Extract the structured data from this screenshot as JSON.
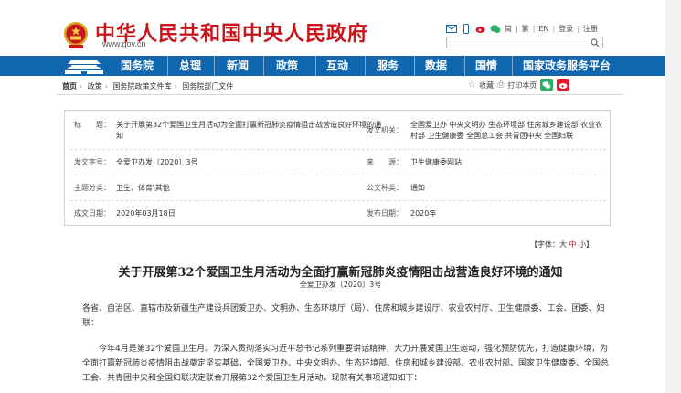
{
  "header": {
    "site_title": "中华人民共和国中央人民政府",
    "site_url": "www.gov.cn",
    "links": [
      "简",
      "繁",
      "EN",
      "登录",
      "注册"
    ],
    "search_placeholder": ""
  },
  "nav": {
    "items": [
      "国务院",
      "总理",
      "新闻",
      "政策",
      "互动",
      "服务",
      "数据",
      "国情",
      "国家政务服务平台"
    ]
  },
  "breadcrumb": {
    "items": [
      "首页",
      "政策",
      "国务院政策文件库",
      "国务院部门文件"
    ]
  },
  "tools": {
    "favorite_label": "收藏",
    "print_label": "打印本页"
  },
  "info": {
    "title_label": "标　　题：",
    "title_value": "关于开展第32个爱国卫生月活动为全面打赢新冠肺炎疫情阻击战营造良好环境的通知",
    "issuer_label": "发文机关：",
    "issuer_value": "全国爱卫办 中央文明办 生态环境部 住房城乡建设部 农业农村部 卫生健康委 全国总工会 共青团中央 全国妇联",
    "docno_label": "发文字号：",
    "docno_value": "全爱卫办发〔2020〕3号",
    "source_label": "来　　源：",
    "source_value": "卫生健康委网站",
    "topic_label": "主题分类：",
    "topic_value": "卫生、体育\\其他",
    "type_label": "公文种类：",
    "type_value": "通知",
    "date_label": "成文日期：",
    "date_value": "2020年03月18日",
    "pub_label": "发布日期：",
    "pub_value": "2020年"
  },
  "fontsize": {
    "label": "【字体：",
    "large": "大",
    "medium": "中",
    "small": "小",
    "end": "】"
  },
  "article": {
    "title": "关于开展第32个爱国卫生月活动为全面打赢新冠肺炎疫情阻击战营造良好环境的通知",
    "doc_number": "全爱卫办发〔2020〕3号",
    "p1": "各省、自治区、直辖市及新疆生产建设兵团爱卫办、文明办、生态环境厅（局）、住房和城乡建设厅、农业农村厅、卫生健康委、工会、团委、妇联：",
    "p2": "今年4月是第32个爱国卫生月。为深入贯彻落实习近平总书记系列重要讲话精神，大力开展爱国卫生运动，强化预防优先，打造健康环境，为全面打赢新冠肺炎疫情阻击战奠定坚实基础，全国爱卫办、中央文明办、生态环境部、住房和城乡建设部、农业农村部、国家卫生健康委、全国总工会、共青团中央和全国妇联决定联合开展第32个爱国卫生月活动。现就有关事项通知如下："
  },
  "colors": {
    "brand_red": "#c8161d",
    "nav_blue": "#1166b0"
  }
}
